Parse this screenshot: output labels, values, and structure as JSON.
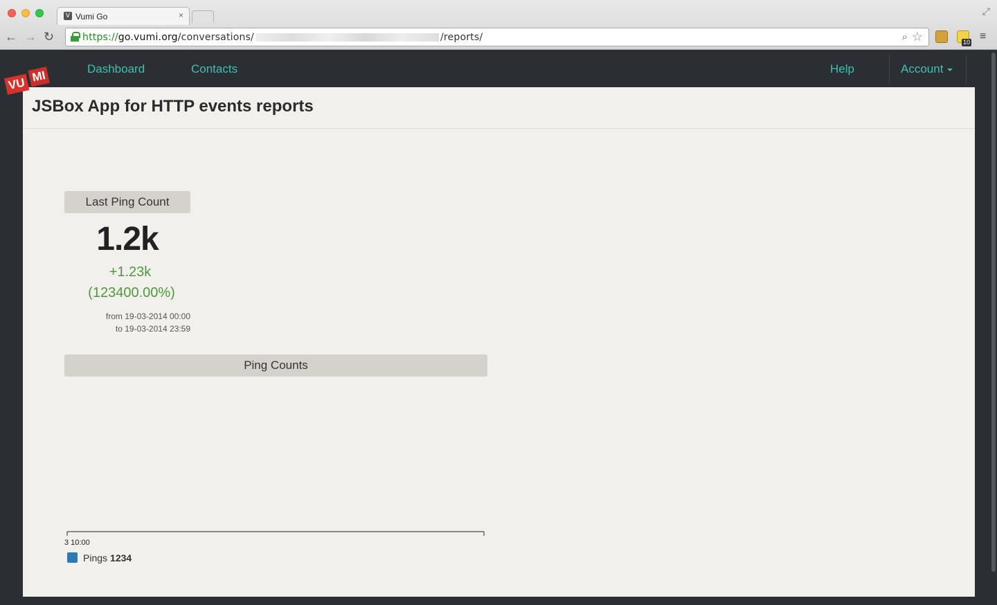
{
  "browser": {
    "tab_title": "Vumi Go",
    "tab_close": "×",
    "favicon": "V",
    "url_scheme": "https://",
    "url_host": "go.vumi.org",
    "url_path_start": "/conversations/",
    "url_path_end": "/reports/",
    "extension_badge": "10",
    "icons": [
      "back-icon",
      "forward-icon",
      "reload-icon",
      "lock-icon",
      "zoom-icon",
      "star-icon",
      "menu-icon"
    ]
  },
  "nav": {
    "logo_vu": "VU",
    "logo_mi": "MI",
    "dashboard": "Dashboard",
    "contacts": "Contacts",
    "help": "Help",
    "account": "Account"
  },
  "page": {
    "title": "JSBox App for HTTP events reports"
  },
  "last_ping_widget": {
    "title": "Last Ping Count",
    "value": "1.2k",
    "diff": "+1.23k",
    "diff_percent": "(123400.00%)",
    "from": "from 19-03-2014 00:00",
    "to": "to 19-03-2014 23:59"
  },
  "ping_counts_widget": {
    "title": "Ping Counts",
    "legend_label": "Pings",
    "legend_value": "1234"
  },
  "colors": {
    "accent": "#3bc1b2",
    "positive": "#4e9a3a",
    "series": "#2b7bba",
    "brand": "#d7332d"
  },
  "chart_data": {
    "type": "line",
    "title": "Ping Counts",
    "xlabel": "",
    "ylabel": "",
    "x_tick_labels": [
      "3 10:00"
    ],
    "series": [
      {
        "name": "Pings",
        "values": [
          1234
        ]
      }
    ],
    "grid": false,
    "legend": "bottom-left"
  }
}
